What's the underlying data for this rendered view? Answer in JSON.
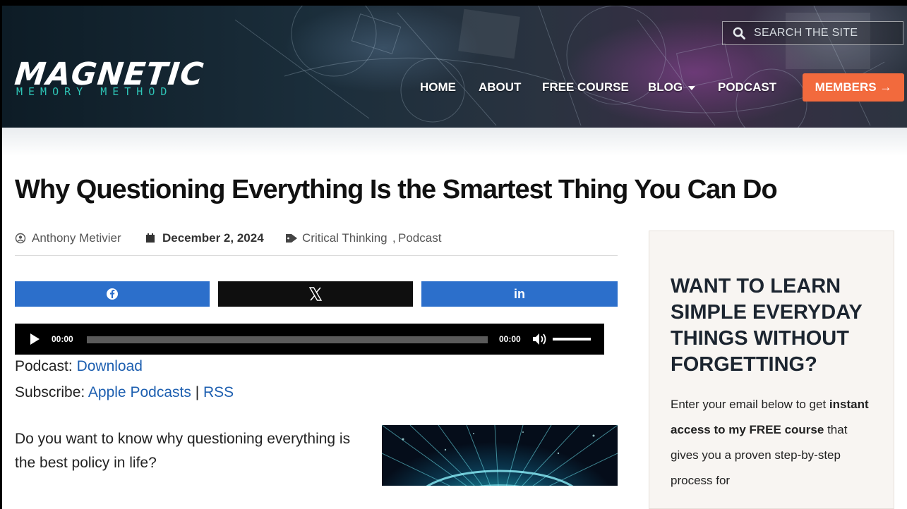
{
  "header": {
    "logo_main": "MAGNETIC",
    "logo_sub": "MEMORY METHOD",
    "search_placeholder": "SEARCH THE SITE",
    "nav": {
      "home": "HOME",
      "about": "ABOUT",
      "free_course": "FREE COURSE",
      "blog": "BLOG",
      "podcast": "PODCAST"
    },
    "members_label": "MEMBERS",
    "members_arrow": "→"
  },
  "article": {
    "title": "Why Questioning Everything Is the Smartest Thing You Can Do",
    "author": "Anthony Metivier",
    "date": "December 2, 2024",
    "categories": [
      "Critical Thinking",
      "Podcast"
    ],
    "category_separator": ",",
    "share": {
      "facebook_color": "#2c6fcb",
      "x_color": "#0f0f0f",
      "linkedin_color": "#2c6fcb",
      "linkedin_label": "in"
    },
    "player": {
      "current_time": "00:00",
      "duration": "00:00"
    },
    "podcast_label": "Podcast:",
    "download_link": "Download",
    "subscribe_label": "Subscribe:",
    "apple_link": "Apple Podcasts",
    "separator": "|",
    "rss_link": "RSS",
    "intro": "Do you want to know why questioning everything is the best policy in life?"
  },
  "sidebar": {
    "heading": "WANT TO LEARN SIMPLE EVERYDAY THINGS WITHOUT FORGETTING?",
    "body_start": "Enter your email below to get",
    "body_bold": "instant access to my FREE course",
    "body_end": "that gives you a proven step-by-step process for"
  },
  "colors": {
    "accent_orange": "#f26a3d",
    "link_blue": "#1d5fb0",
    "logo_teal": "#2ec4b6"
  }
}
